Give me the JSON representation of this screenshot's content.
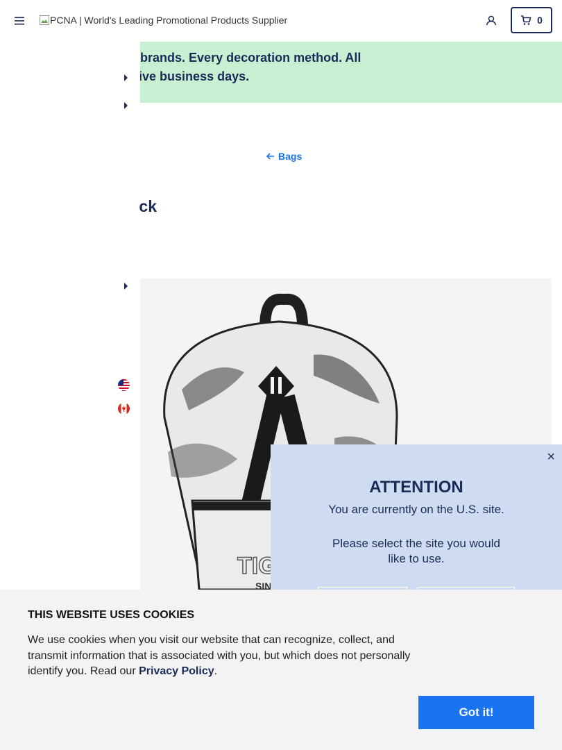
{
  "header": {
    "logo_alt": "PCNA | World's Leading Promotional Products Supplier",
    "cart_count": "0"
  },
  "promo": {
    "line1": "ls of products. Dozens of retail brands. Every decoration method. All",
    "line2": "th a standard lead time of just five business days."
  },
  "breadcrumb": {
    "back_label": "Bags"
  },
  "product": {
    "title_fragment": "ck"
  },
  "attention_popup": {
    "title": "ATTENTION",
    "current_site": "You are currently on the U.S. site.",
    "prompt": "Please select the site you would like to use.",
    "close": "×"
  },
  "cookies": {
    "title": "THIS WEBSITE USES COOKIES",
    "text": "We use cookies when you visit our website that can recognize, collect, and transmit information that is associated with you, but which does not personally identify you. Read our ",
    "link": "Privacy Policy",
    "text_end": ".",
    "button": "Got it!"
  },
  "colors": {
    "brand_navy": "#1b2b57",
    "promo_green": "#c7f0d3",
    "popup_blue": "#cfdbf0",
    "accent_blue": "#1a73f0"
  },
  "icons": [
    "hamburger-menu-icon",
    "broken-image-icon",
    "user-icon",
    "cart-icon",
    "arrow-left-icon",
    "us-flag-icon",
    "canada-flag-icon",
    "close-icon",
    "caret-right-icon"
  ]
}
